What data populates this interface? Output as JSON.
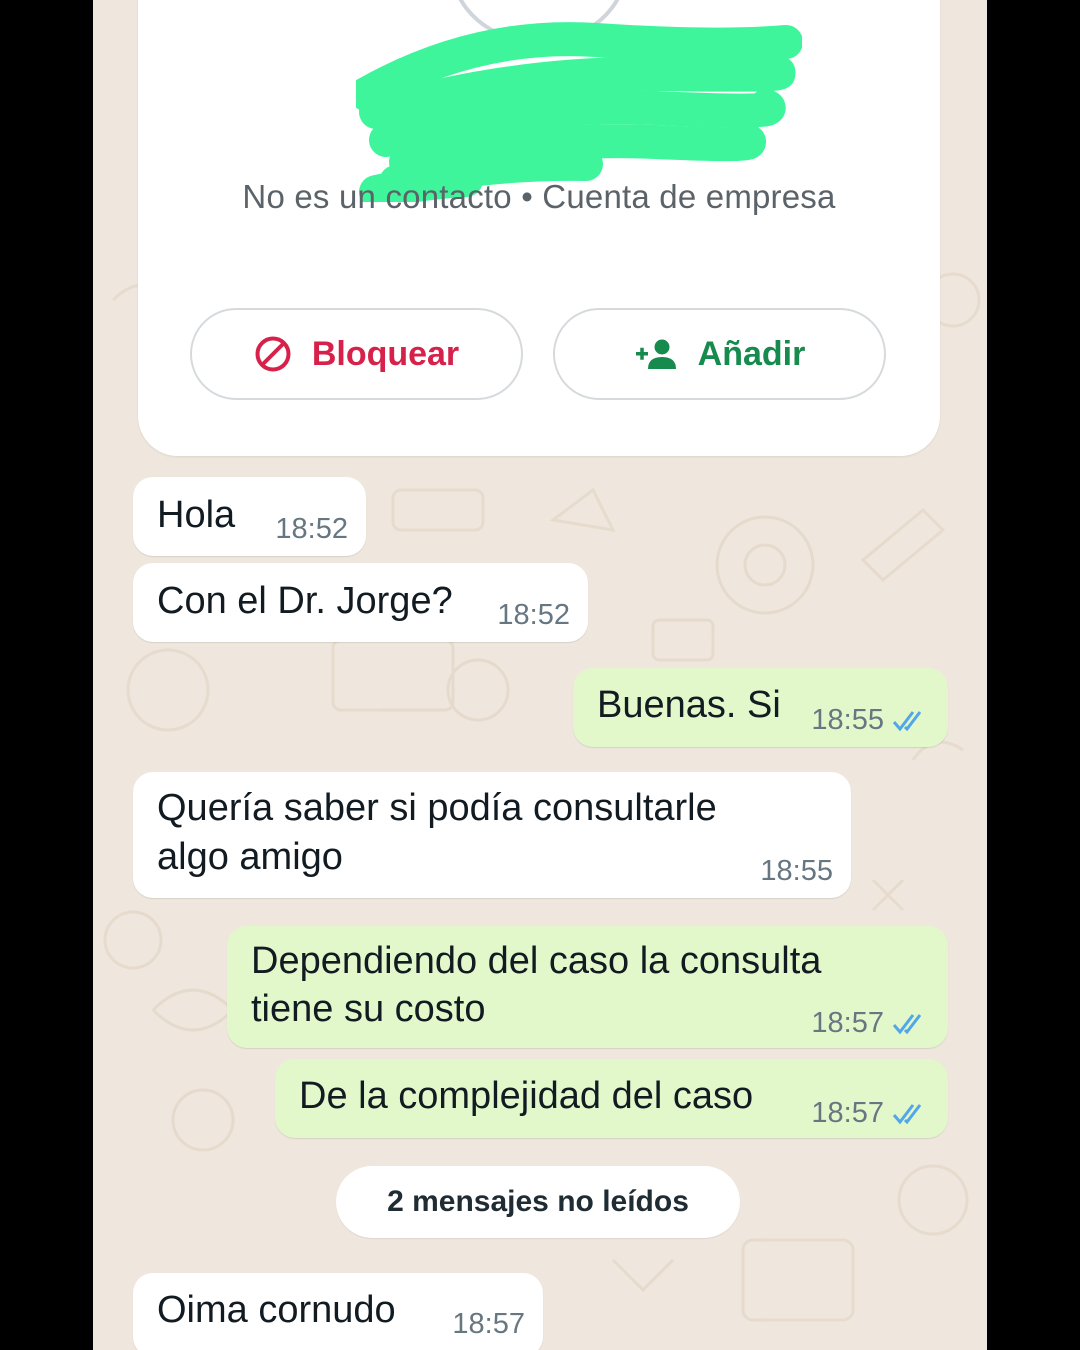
{
  "contact": {
    "subtitle": "No es un contacto • Cuenta de empresa",
    "block_label": "Bloquear",
    "add_label": "Añadir",
    "redaction_color": "#3ff59c"
  },
  "messages": [
    {
      "direction": "in",
      "text": "Hola",
      "time": "18:52"
    },
    {
      "direction": "in",
      "text": "Con el Dr. Jorge?",
      "time": "18:52"
    },
    {
      "direction": "out",
      "text": "Buenas. Si",
      "time": "18:55",
      "status": "read"
    },
    {
      "direction": "in",
      "text_line1": "Quería saber si podía consultarle",
      "text_line2": "algo amigo",
      "time": "18:55"
    },
    {
      "direction": "out",
      "text_line1": "Dependiendo del caso la consulta",
      "text_line2": "tiene su costo",
      "time": "18:57",
      "status": "read"
    },
    {
      "direction": "out",
      "text": "De la complejidad del caso",
      "time": "18:57",
      "status": "read"
    },
    {
      "direction": "in",
      "text": "Oima cornudo",
      "time": "18:57"
    }
  ],
  "unread_banner": "2 mensajes no leídos",
  "colors": {
    "incoming_bubble": "#ffffff",
    "outgoing_bubble": "#e2f8cb",
    "chat_background": "#efe7dd",
    "block_red": "#d6224b",
    "add_green": "#178a4e",
    "read_tick_blue": "#53a6e8"
  }
}
